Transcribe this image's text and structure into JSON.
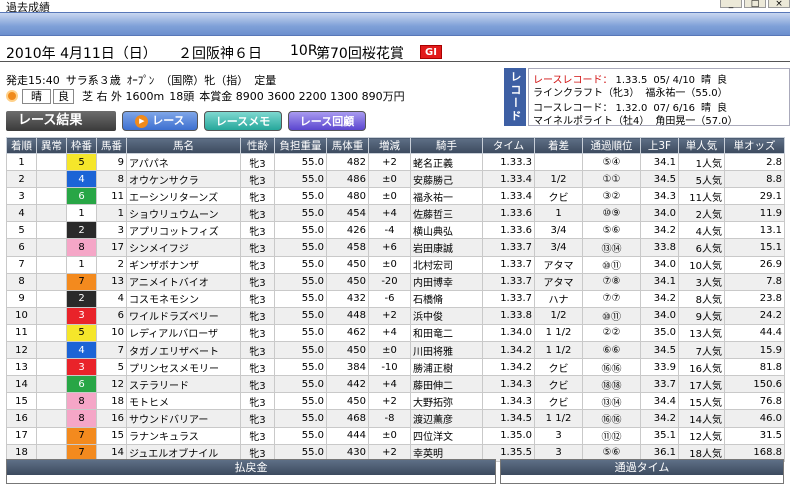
{
  "window": {
    "title": "過去成績",
    "minimize": "_",
    "maximize": "□",
    "close": "×"
  },
  "race": {
    "date": "2010年 4月11日（日）",
    "meeting": "２回阪神６日",
    "race_no": "10R",
    "name": "第70回桜花賞",
    "grade": "GI",
    "post_time": "発走15:40",
    "class": "サラ系３歳",
    "open": "ｵｰﾌﾟﾝ",
    "conditions": "（国際）牝（指）",
    "weight_rule": "定量",
    "weather": "晴",
    "going": "良",
    "track": "芝 右 外 1600m",
    "heads": "18頭",
    "prize": "本賞金 8900 3600 2200 1300 890万円"
  },
  "record": {
    "tab": "レコード",
    "race_record_label": "レースレコード：",
    "race_record_time": "1.33.5",
    "race_record_date": "05/ 4/10",
    "race_record_weather": "晴",
    "race_record_going": "良",
    "race_record_horse": "ラインクラフト（牝3）",
    "race_record_jockey": "福永祐一（55.0）",
    "course_record_label": "コースレコード：",
    "course_record_time": "1.32.0",
    "course_record_date": "07/ 6/16",
    "course_record_weather": "晴",
    "course_record_going": "良",
    "course_record_horse": "マイネルポライト（牡4）",
    "course_record_jockey": "角田晃一（57.0）"
  },
  "toolbar": {
    "result_label": "レース結果",
    "race_button": "レース",
    "memo_button": "レースメモ",
    "review_button": "レース回顧"
  },
  "table": {
    "headers": [
      "着順",
      "異常",
      "枠番",
      "馬番",
      "馬名",
      "性齢",
      "負担重量",
      "馬体重",
      "増減",
      "騎手",
      "タイム",
      "着差",
      "通過順位",
      "上3F",
      "単人気",
      "単オッズ"
    ],
    "rows": [
      [
        "1",
        "",
        "5",
        "9",
        "アパパネ",
        "牝3",
        "55.0",
        "482",
        "+2",
        "蛯名正義",
        "1.33.3",
        "",
        "⑤④",
        "34.1",
        "1人気",
        "2.8"
      ],
      [
        "2",
        "",
        "4",
        "8",
        "オウケンサクラ",
        "牝3",
        "55.0",
        "486",
        "±0",
        "安藤勝己",
        "1.33.4",
        "1/2",
        "①①",
        "34.5",
        "5人気",
        "8.8"
      ],
      [
        "3",
        "",
        "6",
        "11",
        "エーシンリターンズ",
        "牝3",
        "55.0",
        "480",
        "±0",
        "福永祐一",
        "1.33.4",
        "クビ",
        "③②",
        "34.3",
        "11人気",
        "29.1"
      ],
      [
        "4",
        "",
        "1",
        "1",
        "ショウリュウムーン",
        "牝3",
        "55.0",
        "454",
        "+4",
        "佐藤哲三",
        "1.33.6",
        "1",
        "⑩⑨",
        "34.0",
        "2人気",
        "11.9"
      ],
      [
        "5",
        "",
        "2",
        "3",
        "アプリコットフィズ",
        "牝3",
        "55.0",
        "426",
        "-4",
        "横山典弘",
        "1.33.6",
        "3/4",
        "⑤⑥",
        "34.2",
        "4人気",
        "13.1"
      ],
      [
        "6",
        "",
        "8",
        "17",
        "シンメイフジ",
        "牝3",
        "55.0",
        "458",
        "+6",
        "岩田康誠",
        "1.33.7",
        "3/4",
        "⑬⑭",
        "33.8",
        "6人気",
        "15.1"
      ],
      [
        "7",
        "",
        "1",
        "2",
        "ギンザボナンザ",
        "牝3",
        "55.0",
        "450",
        "±0",
        "北村宏司",
        "1.33.7",
        "アタマ",
        "⑩⑪",
        "34.0",
        "10人気",
        "26.9"
      ],
      [
        "8",
        "",
        "7",
        "13",
        "アニメイトバイオ",
        "牝3",
        "55.0",
        "450",
        "-20",
        "内田博幸",
        "1.33.7",
        "アタマ",
        "⑦⑧",
        "34.1",
        "3人気",
        "7.8"
      ],
      [
        "9",
        "",
        "2",
        "4",
        "コスモネモシン",
        "牝3",
        "55.0",
        "432",
        "-6",
        "石橋脩",
        "1.33.7",
        "ハナ",
        "⑦⑦",
        "34.2",
        "8人気",
        "23.8"
      ],
      [
        "10",
        "",
        "3",
        "6",
        "ワイルドラズベリー",
        "牝3",
        "55.0",
        "448",
        "+2",
        "浜中俊",
        "1.33.8",
        "1/2",
        "⑩⑪",
        "34.0",
        "9人気",
        "24.2"
      ],
      [
        "11",
        "",
        "5",
        "10",
        "レディアルバローザ",
        "牝3",
        "55.0",
        "462",
        "+4",
        "和田竜二",
        "1.34.0",
        "1 1/2",
        "②②",
        "35.0",
        "13人気",
        "44.4"
      ],
      [
        "12",
        "",
        "4",
        "7",
        "タガノエリザベート",
        "牝3",
        "55.0",
        "450",
        "±0",
        "川田将雅",
        "1.34.2",
        "1 1/2",
        "⑥⑥",
        "34.5",
        "7人気",
        "15.9"
      ],
      [
        "13",
        "",
        "3",
        "5",
        "プリンセスメモリー",
        "牝3",
        "55.0",
        "384",
        "-10",
        "勝浦正樹",
        "1.34.2",
        "クビ",
        "⑯⑯",
        "33.9",
        "16人気",
        "81.8"
      ],
      [
        "14",
        "",
        "6",
        "12",
        "ステラリード",
        "牝3",
        "55.0",
        "442",
        "+4",
        "藤田伸二",
        "1.34.3",
        "クビ",
        "⑱⑱",
        "33.7",
        "17人気",
        "150.6"
      ],
      [
        "15",
        "",
        "8",
        "18",
        "モトヒメ",
        "牝3",
        "55.0",
        "450",
        "+2",
        "大野拓弥",
        "1.34.3",
        "クビ",
        "⑬⑭",
        "34.4",
        "15人気",
        "76.8"
      ],
      [
        "16",
        "",
        "8",
        "16",
        "サウンドバリアー",
        "牝3",
        "55.0",
        "468",
        "-8",
        "渡辺薫彦",
        "1.34.5",
        "1 1/2",
        "⑯⑯",
        "34.2",
        "14人気",
        "46.0"
      ],
      [
        "17",
        "",
        "7",
        "15",
        "ラナンキュラス",
        "牝3",
        "55.0",
        "444",
        "±0",
        "四位洋文",
        "1.35.0",
        "3",
        "⑪⑫",
        "35.1",
        "12人気",
        "31.5"
      ],
      [
        "18",
        "",
        "7",
        "14",
        "ジュエルオブナイル",
        "牝3",
        "55.0",
        "430",
        "+2",
        "幸英明",
        "1.35.5",
        "3",
        "⑤⑥",
        "36.1",
        "18人気",
        "168.8"
      ]
    ]
  },
  "bottom": {
    "payout_title": "払戻金",
    "pass_time_title": "通過タイム"
  }
}
